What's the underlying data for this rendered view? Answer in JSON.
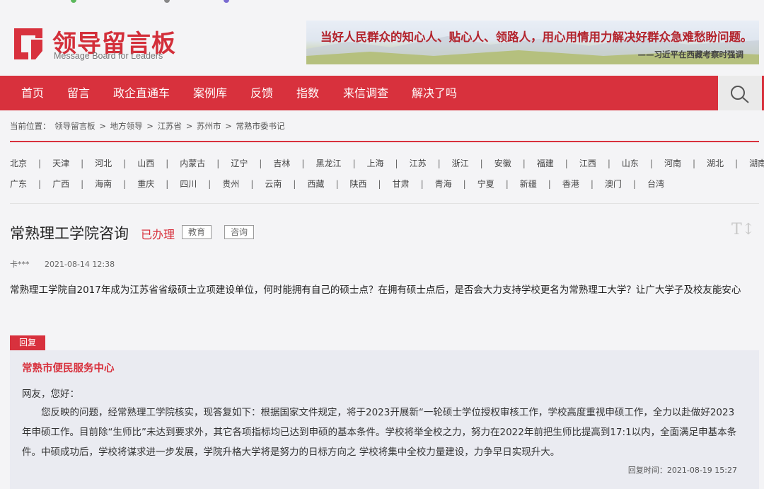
{
  "site": {
    "logo_title": "领导留言板",
    "logo_subtitle": "Message Board for Leaders",
    "banner_quote": "当好人民群众的知心人、贴心人、领路人，用心用情用力解决好群众急难愁盼问题。",
    "banner_author": "——习近平在西藏考察时强调"
  },
  "nav": {
    "items": [
      "首页",
      "留言",
      "政企直通车",
      "案例库",
      "反馈",
      "指数",
      "来信调查",
      "解决了吗"
    ],
    "search_icon": "search-icon"
  },
  "breadcrumb": {
    "prefix": "当前位置：",
    "items": [
      "领导留言板",
      "地方领导",
      "江苏省",
      "苏州市",
      "常熟市委书记"
    ],
    "separator": ">"
  },
  "regions": {
    "row1": [
      "北京",
      "天津",
      "河北",
      "山西",
      "内蒙古",
      "辽宁",
      "吉林",
      "黑龙江",
      "上海",
      "江苏",
      "浙江",
      "安徽",
      "福建",
      "江西",
      "山东",
      "河南",
      "湖北",
      "湖南"
    ],
    "row2": [
      "广东",
      "广西",
      "海南",
      "重庆",
      "四川",
      "贵州",
      "云南",
      "西藏",
      "陕西",
      "甘肃",
      "青海",
      "宁夏",
      "新疆",
      "香港",
      "澳门",
      "台湾"
    ]
  },
  "message": {
    "title": "常熟理工学院咨询",
    "status": "已办理",
    "tags": [
      "教育",
      "咨询"
    ],
    "font_size_icon": "T↕",
    "author": "卡***",
    "date": "2021-08-14 12:38",
    "body": "常熟理工学院自2017年成为江苏省省级硕士立项建设单位，何时能拥有自己的硕士点？在拥有硕士点后，是否会大力支持学校更名为常熟理工大学？让广大学子及校友能安心"
  },
  "reply": {
    "badge": "回复",
    "org": "常熟市便民服务中心",
    "greeting": "网友，您好：",
    "body": "您反映的问题，经常熟理工学院核实，现答复如下：根据国家文件规定，将于2023开展新“一轮硕士学位授权审核工作，学校高度重视申硕工作，全力以赴做好2023年申硕工作。目前除“生师比”未达到要求外，其它各项指标均已达到申硕的基本条件。学校将举全校之力，努力在2022年前把生师比提高到17:1以内，全面满足申基本条件。中硕成功后，学校将谋求进一步发展，学院升格大学将是努力的日标方向之 学校将集中全校力量建设，力争早日实现升大。",
    "time_label": "回复时间：2021-08-19 15:27"
  },
  "colors": {
    "brand_red": "#d8313d",
    "nav_bg": "#d8313d",
    "reply_bg": "#eaebf1"
  }
}
